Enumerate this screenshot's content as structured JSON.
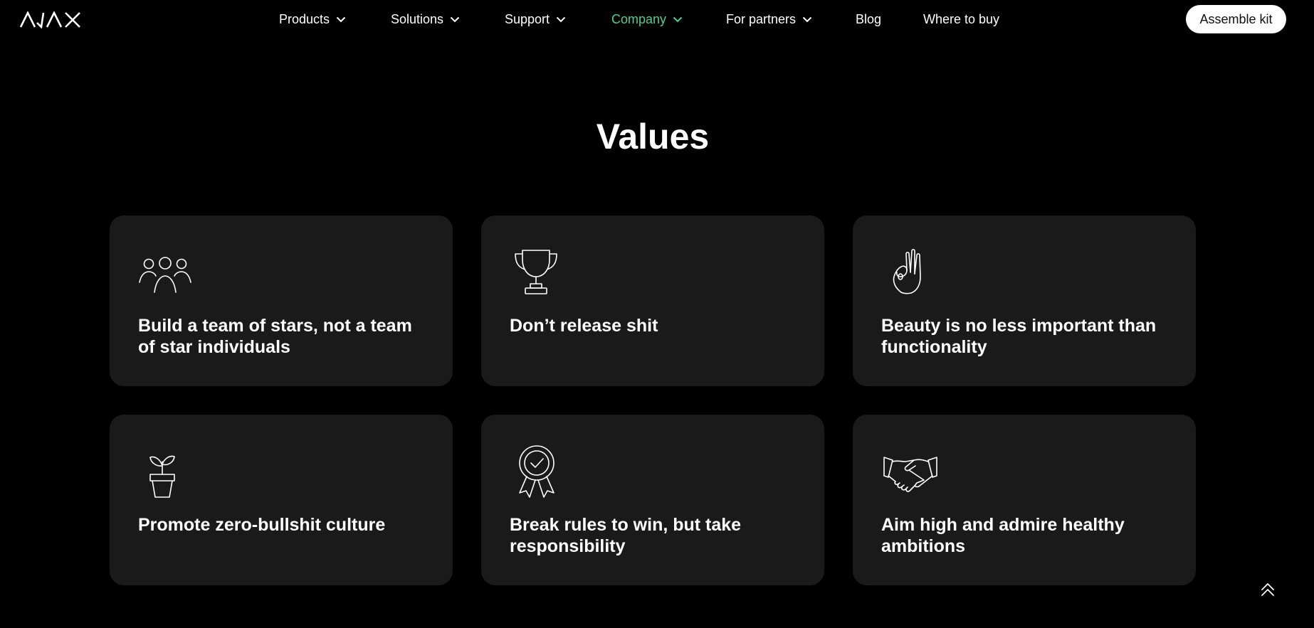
{
  "header": {
    "logo_text": "AJAX",
    "nav": [
      {
        "label": "Products",
        "has_dropdown": true,
        "active": false
      },
      {
        "label": "Solutions",
        "has_dropdown": true,
        "active": false
      },
      {
        "label": "Support",
        "has_dropdown": true,
        "active": false
      },
      {
        "label": "Company",
        "has_dropdown": true,
        "active": true
      },
      {
        "label": "For partners",
        "has_dropdown": true,
        "active": false
      },
      {
        "label": "Blog",
        "has_dropdown": false,
        "active": false
      },
      {
        "label": "Where to buy",
        "has_dropdown": false,
        "active": false
      }
    ],
    "cta_label": "Assemble kit"
  },
  "section": {
    "title": "Values",
    "cards": [
      {
        "icon": "team-icon",
        "text": "Build a team of stars, not a team of star individuals"
      },
      {
        "icon": "trophy-icon",
        "text": "Don’t release shit"
      },
      {
        "icon": "ok-hand-icon",
        "text": "Beauty is no less important than functionality"
      },
      {
        "icon": "sprout-pot-icon",
        "text": "Promote zero-bullshit culture"
      },
      {
        "icon": "award-ribbon-icon",
        "text": "Break rules to win, but take responsibility"
      },
      {
        "icon": "handshake-icon",
        "text": "Aim high and admire healthy ambitions"
      }
    ]
  },
  "scroll_top_icon": "double-chevron-up-icon",
  "colors": {
    "background": "#000000",
    "card": "#1a1a1b",
    "text": "#ffffff",
    "accent": "#4fd08e"
  }
}
